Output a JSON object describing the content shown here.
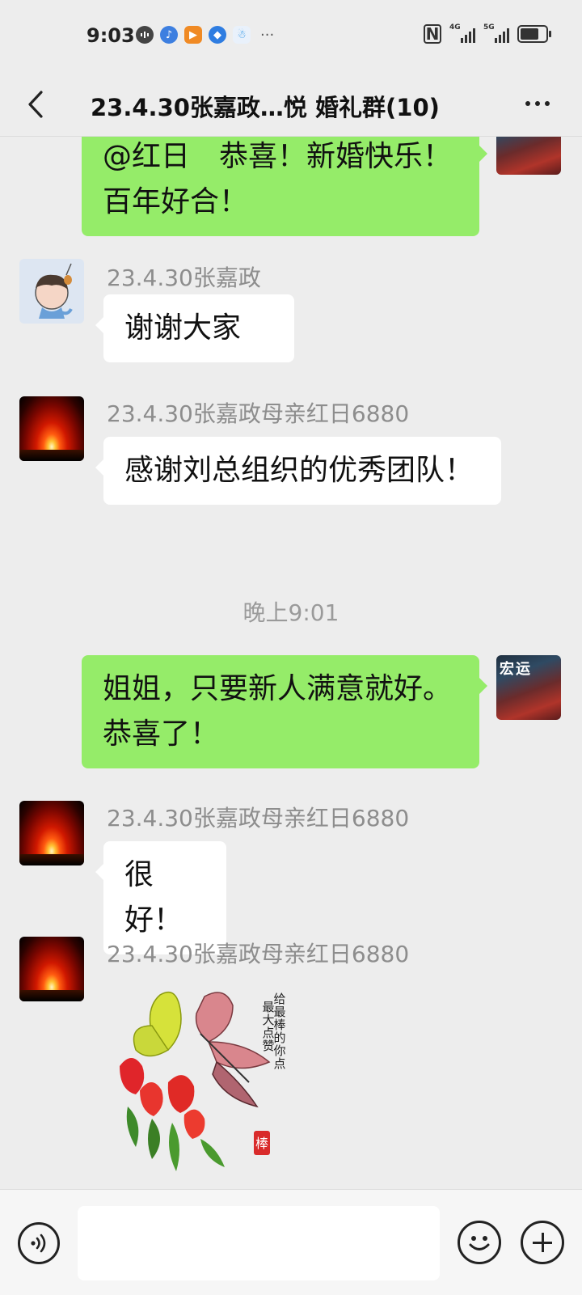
{
  "status_bar": {
    "time": "9:03",
    "more_indicator": "···",
    "network_1": "4G",
    "network_2": "5G",
    "battery_level": 0.85,
    "icons": [
      "media-icon",
      "music-icon",
      "video-app-icon",
      "browser-icon",
      "qq-icon",
      "nfc-icon",
      "signal-icon",
      "battery-icon"
    ]
  },
  "header": {
    "title": "23.4.30张嘉政…悦 婚礼群(10)"
  },
  "messages": [
    {
      "type": "outgoing",
      "text": "@红日　恭喜！新婚快乐！百年好合！"
    },
    {
      "type": "incoming",
      "sender": "23.4.30张嘉政",
      "text": "谢谢大家"
    },
    {
      "type": "incoming",
      "sender": "23.4.30张嘉政母亲红日6880",
      "text": "感谢刘总组织的优秀团队！"
    },
    {
      "type": "time",
      "text": "晚上9:01"
    },
    {
      "type": "outgoing",
      "text": "姐姐，只要新人满意就好。恭喜了！"
    },
    {
      "type": "incoming",
      "sender": "23.4.30张嘉政母亲红日6880",
      "text": "很好！"
    },
    {
      "type": "incoming-sticker",
      "sender": "23.4.30张嘉政母亲红日6880",
      "sticker_text": "给最棒的你点最大点赞",
      "sticker_seal": "棒"
    }
  ],
  "avatar_shop_sign": "宏运",
  "input_bar": {
    "placeholder": ""
  },
  "colors": {
    "background": "#ededed",
    "outgoing_bubble": "#95ec69",
    "incoming_bubble": "#ffffff",
    "sender_name": "#8d8d8d"
  }
}
